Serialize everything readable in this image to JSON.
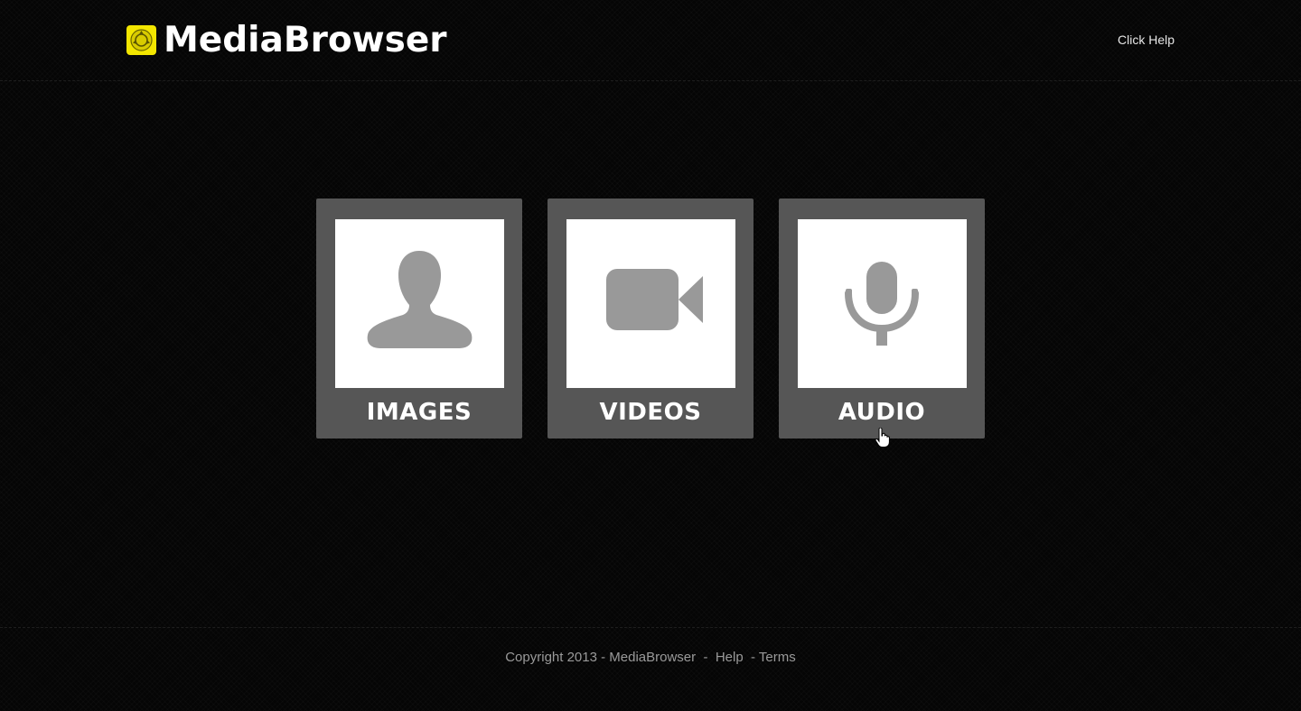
{
  "header": {
    "brand": "MediaBrowser",
    "help_link": "Click Help",
    "logo_icon": "refresh-cycle-icon",
    "logo_color": "#f3e600"
  },
  "tiles": [
    {
      "label": "IMAGES",
      "icon": "person-icon"
    },
    {
      "label": "VIDEOS",
      "icon": "video-camera-icon"
    },
    {
      "label": "AUDIO",
      "icon": "microphone-icon"
    }
  ],
  "footer": {
    "copyright": "Copyright 2013 - MediaBrowser",
    "sep1": "  -  ",
    "help": "Help",
    "sep2": "  - ",
    "terms": "Terms"
  },
  "colors": {
    "background": "#050505",
    "tile_frame": "#565656",
    "icon_gray": "#999999",
    "footer_text": "#9a9a9a"
  }
}
